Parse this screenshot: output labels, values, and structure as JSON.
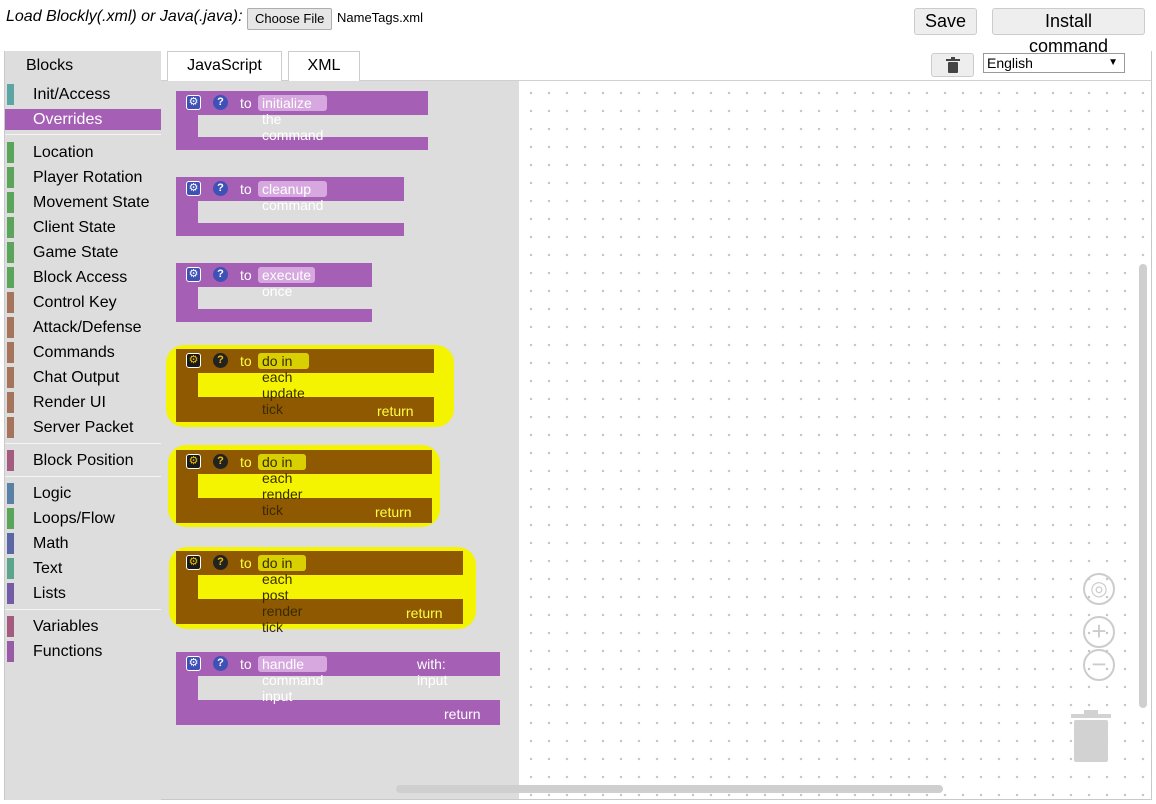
{
  "topbar": {
    "load_label": "Load Blockly(.xml) or Java(.java):",
    "choose_file": "Choose File",
    "file_name": "NameTags.xml",
    "save": "Save",
    "install": "Install command"
  },
  "toolbox": {
    "title": "Blocks",
    "items": [
      {
        "label": "Init/Access",
        "color": "#5ba5a5"
      },
      {
        "label": "Overrides",
        "color": "#a55fb4",
        "selected": true
      },
      {
        "label": "Location",
        "color": "#5ba55b"
      },
      {
        "label": "Player Rotation",
        "color": "#5ba55b"
      },
      {
        "label": "Movement State",
        "color": "#5ba55b"
      },
      {
        "label": "Client State",
        "color": "#5ba55b"
      },
      {
        "label": "Game State",
        "color": "#5ba55b"
      },
      {
        "label": "Block Access",
        "color": "#5ba55b"
      },
      {
        "label": "Control Key",
        "color": "#a5745b"
      },
      {
        "label": "Attack/Defense",
        "color": "#a5745b"
      },
      {
        "label": "Commands",
        "color": "#a5745b"
      },
      {
        "label": "Chat Output",
        "color": "#a5745b"
      },
      {
        "label": "Render UI",
        "color": "#a5745b"
      },
      {
        "label": "Server Packet",
        "color": "#a5745b"
      },
      {
        "label": "Block Position",
        "color": "#a55b80"
      },
      {
        "label": "Logic",
        "color": "#5b80a5"
      },
      {
        "label": "Loops/Flow",
        "color": "#5ba55b"
      },
      {
        "label": "Math",
        "color": "#5b67a5"
      },
      {
        "label": "Text",
        "color": "#5ba58c"
      },
      {
        "label": "Lists",
        "color": "#745ba5"
      },
      {
        "label": "Variables",
        "color": "#a55b80"
      },
      {
        "label": "Functions",
        "color": "#995ba5"
      }
    ]
  },
  "tabs": {
    "javascript": "JavaScript",
    "xml": "XML"
  },
  "language": {
    "selected": "English"
  },
  "blocks": [
    {
      "to": "to",
      "name": "initialize the command",
      "color": "#a55fb4"
    },
    {
      "to": "to",
      "name": "cleanup command",
      "color": "#a55fb4"
    },
    {
      "to": "to",
      "name": "execute once",
      "color": "#a55fb4"
    },
    {
      "to": "to",
      "name": "do in each update tick",
      "return": "return",
      "color": "#8f5902",
      "highlighted": true
    },
    {
      "to": "to",
      "name": "do in each render tick",
      "return": "return",
      "color": "#8f5902",
      "highlighted": true
    },
    {
      "to": "to",
      "name": "do in each post render tick",
      "return": "return",
      "color": "#8f5902",
      "highlighted": true
    },
    {
      "to": "to",
      "name": "handle command input",
      "with": "with: input",
      "return": "return",
      "color": "#a55fb4"
    }
  ]
}
